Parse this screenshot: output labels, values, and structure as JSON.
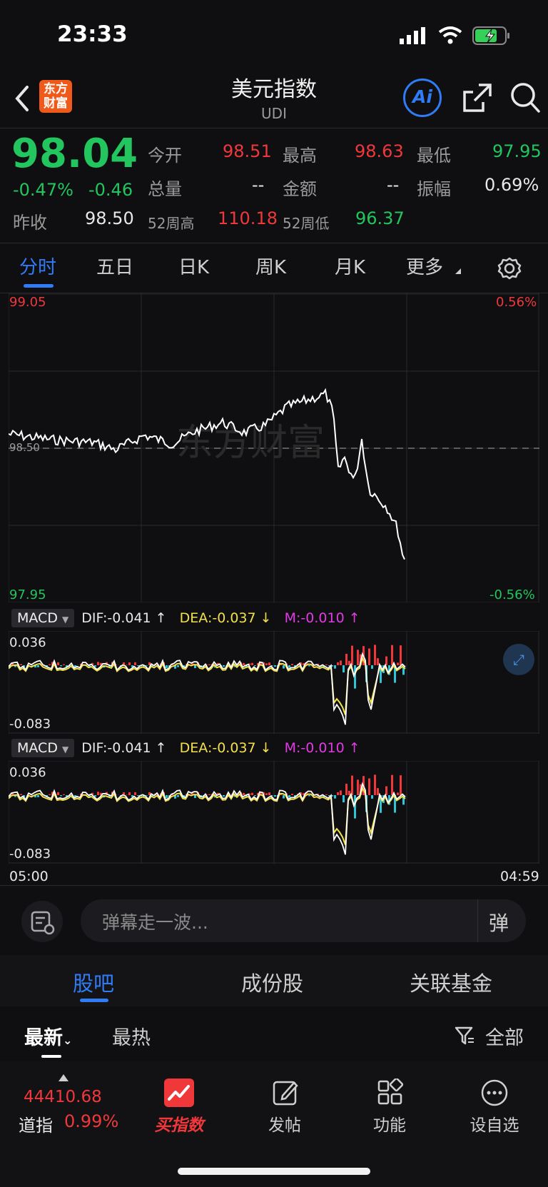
{
  "status": {
    "time": "23:33"
  },
  "header": {
    "logo_text": "东方\n财富",
    "title": "美元指数",
    "subtitle": "UDI",
    "ai_label": "Ai"
  },
  "quote": {
    "price": "98.04",
    "pct": "-0.47%",
    "change": "-0.46",
    "open_label": "今开",
    "open": "98.51",
    "high_label": "最高",
    "high": "98.63",
    "low_label": "最低",
    "low": "97.95",
    "vol_label": "总量",
    "vol": "--",
    "amount_label": "金额",
    "amount": "--",
    "amp_label": "振幅",
    "amp": "0.69%",
    "prev_label": "昨收",
    "prev": "98.50",
    "w52h_label": "52周高",
    "w52h": "110.18",
    "w52l_label": "52周低",
    "w52l": "96.37"
  },
  "tabs": [
    "分时",
    "五日",
    "日K",
    "周K",
    "月K",
    "更多"
  ],
  "chart": {
    "top_price": "99.05",
    "top_pct": "0.56%",
    "bottom_price": "97.95",
    "bottom_pct": "-0.56%",
    "baseline_label": "98.50",
    "watermark": "东方财富"
  },
  "macd": [
    {
      "name": "MACD",
      "dif": "DIF:-0.041 ↑",
      "dea": "DEA:-0.037 ↓",
      "m": "M:-0.010 ↑",
      "top": "0.036",
      "bottom": "-0.083"
    },
    {
      "name": "MACD",
      "dif": "DIF:-0.041 ↑",
      "dea": "DEA:-0.037 ↓",
      "m": "M:-0.010 ↑",
      "top": "0.036",
      "bottom": "-0.083"
    }
  ],
  "time_axis": {
    "start": "05:00",
    "end": "04:59"
  },
  "barrage": {
    "placeholder": "弹幕走一波...",
    "btn": "弹"
  },
  "subtabs": [
    "股吧",
    "成份股",
    "关联基金"
  ],
  "filters": {
    "latest": "最新",
    "hot": "最热",
    "all": "全部"
  },
  "bottom": {
    "index_value": "44410.68",
    "index_name": "道指",
    "index_pct": "0.99%",
    "nav": [
      "买指数",
      "发帖",
      "功能",
      "设自选"
    ]
  },
  "colors": {
    "up": "#f0383b",
    "down": "#22c55e",
    "accent": "#2f7cf6",
    "dea": "#f3e04b",
    "macd_m": "#e23be6",
    "bar_down": "#2ec6d6"
  }
}
